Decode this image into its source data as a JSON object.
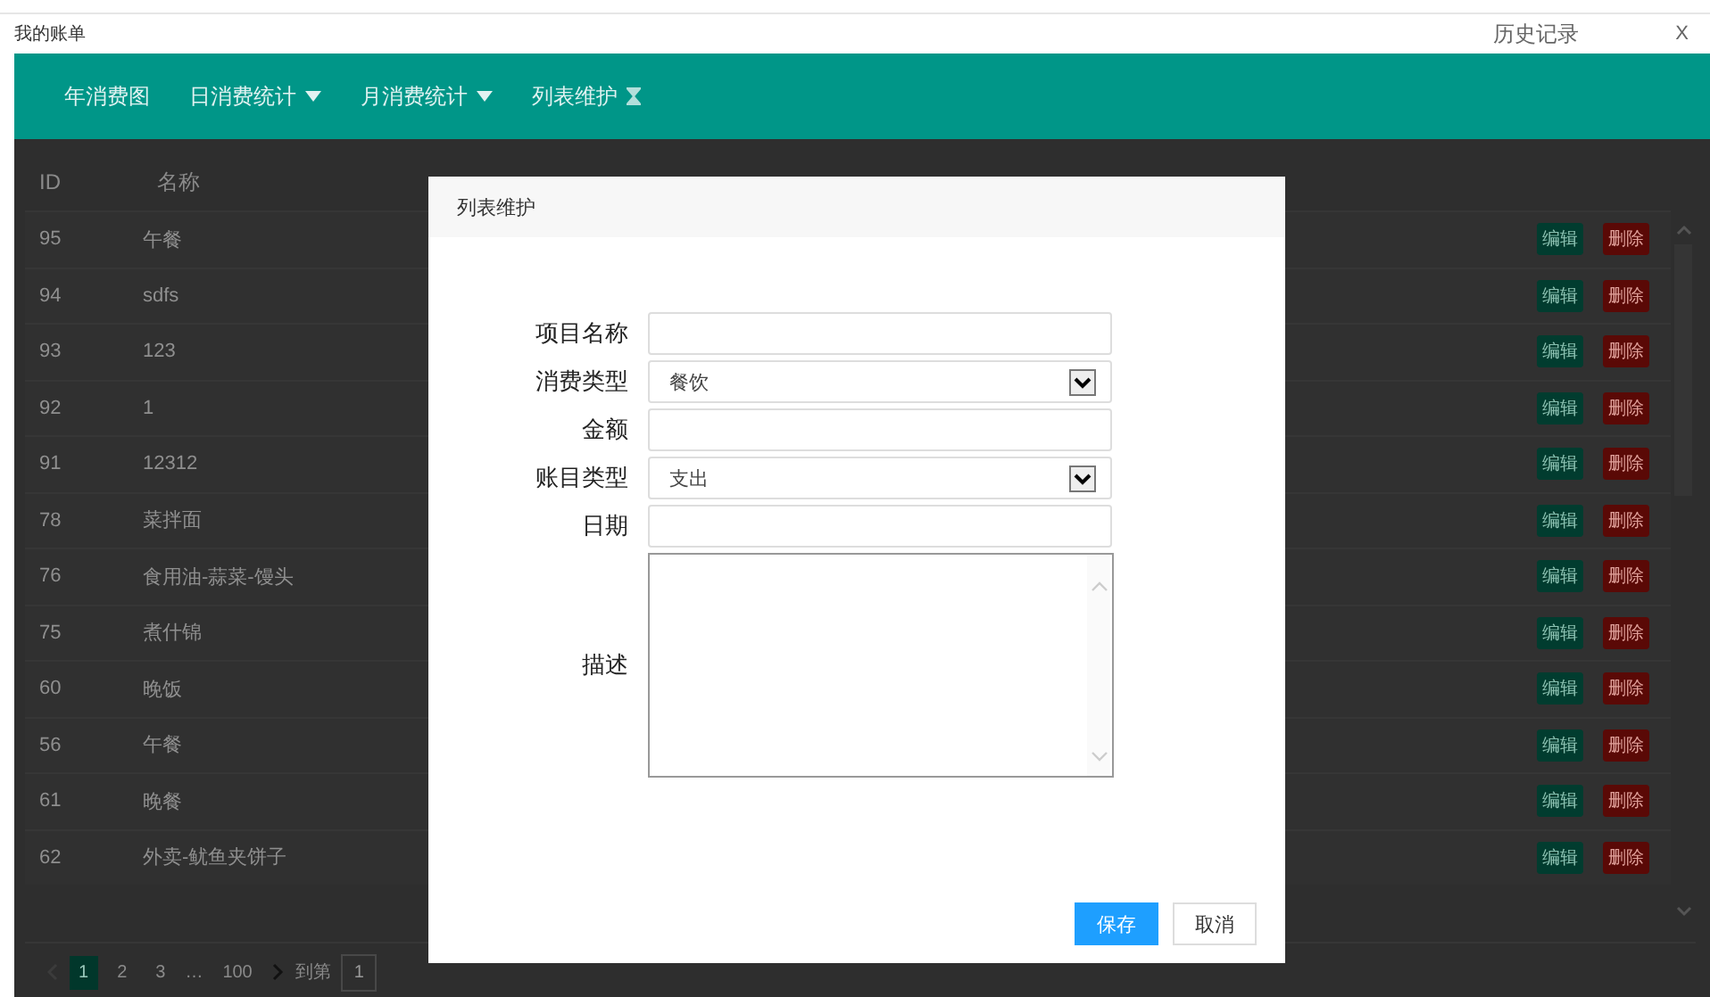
{
  "window": {
    "title": "我的账单",
    "history": "历史记录",
    "close": "X"
  },
  "nav": [
    {
      "label": "年消费图",
      "kind": "plain"
    },
    {
      "label": "日消费统计",
      "kind": "dropdown"
    },
    {
      "label": "月消费统计",
      "kind": "dropdown"
    },
    {
      "label": "列表维护",
      "kind": "hourglass"
    }
  ],
  "table": {
    "columns": [
      "ID",
      "名称"
    ],
    "rows": [
      {
        "id": "95",
        "name": "午餐",
        "edit": "编辑",
        "delete": "删除"
      },
      {
        "id": "94",
        "name": "sdfs",
        "edit": "编辑",
        "delete": "删除"
      },
      {
        "id": "93",
        "name": "123",
        "edit": "编辑",
        "delete": "删除"
      },
      {
        "id": "92",
        "name": "1",
        "edit": "编辑",
        "delete": "删除"
      },
      {
        "id": "91",
        "name": "12312",
        "edit": "编辑",
        "delete": "删除"
      },
      {
        "id": "78",
        "name": "菜拌面",
        "edit": "编辑",
        "delete": "删除"
      },
      {
        "id": "76",
        "name": "食用油-蒜菜-馒头",
        "edit": "编辑",
        "delete": "删除"
      },
      {
        "id": "75",
        "name": "煮什锦",
        "edit": "编辑",
        "delete": "删除"
      },
      {
        "id": "60",
        "name": "晚饭",
        "edit": "编辑",
        "delete": "删除"
      },
      {
        "id": "56",
        "name": "午餐",
        "edit": "编辑",
        "delete": "删除"
      },
      {
        "id": "61",
        "name": "晚餐",
        "edit": "编辑",
        "delete": "删除"
      },
      {
        "id": "62",
        "name": "外卖-鱿鱼夹饼子",
        "edit": "编辑",
        "delete": "删除"
      }
    ]
  },
  "pagination": {
    "pages": [
      {
        "label": "1",
        "selected": true
      },
      {
        "label": "2",
        "selected": false
      },
      {
        "label": "3",
        "selected": false
      }
    ],
    "ellipsis": "…",
    "last": "100",
    "goto_label": "到第",
    "goto_value": "1"
  },
  "dialog": {
    "title": "列表维护",
    "fields": [
      {
        "label": "项目名称",
        "kind": "text"
      },
      {
        "label": "消费类型",
        "kind": "select",
        "value": "餐饮"
      },
      {
        "label": "金额",
        "kind": "text"
      },
      {
        "label": "账目类型",
        "kind": "select",
        "value": "支出"
      },
      {
        "label": "日期",
        "kind": "text"
      },
      {
        "label": "描述",
        "kind": "textarea"
      }
    ],
    "buttons": [
      {
        "label": "保存",
        "primary": true
      },
      {
        "label": "取消",
        "primary": false
      }
    ]
  }
}
